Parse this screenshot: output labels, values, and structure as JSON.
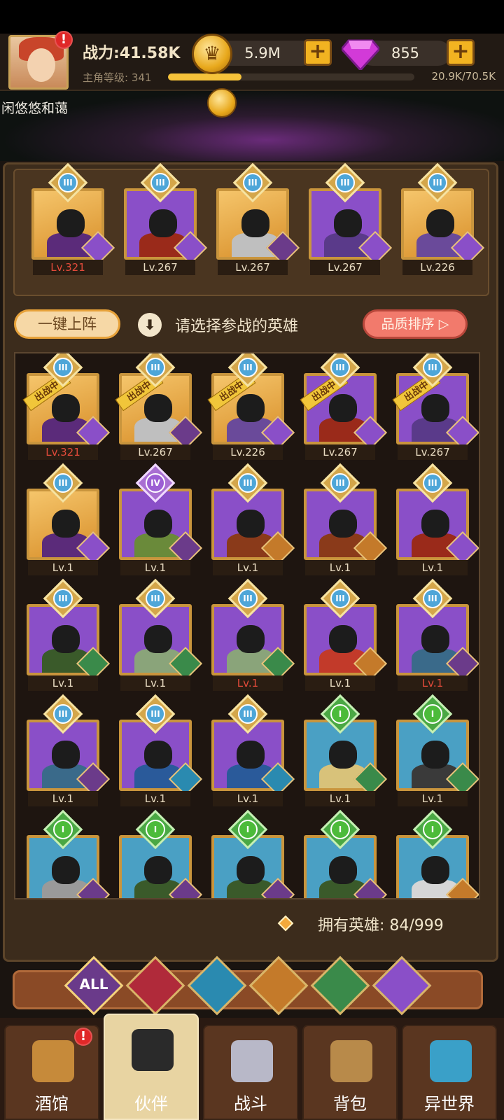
{
  "header": {
    "power": "战力:41.58K",
    "level_label": "主角等级: 341",
    "xp_text": "20.9K/70.5K",
    "xp_progress": 0.297,
    "gold": "5.9M",
    "gems": "855",
    "alert": "!"
  },
  "scene": {
    "player_name": "闲悠悠和蔼"
  },
  "team": [
    {
      "level": "Lv.321",
      "red": true,
      "bg": "gold",
      "rank": "III",
      "hero": "#5b2b7a",
      "faction": "#8a4fc8"
    },
    {
      "level": "Lv.267",
      "red": false,
      "bg": "purple",
      "rank": "III",
      "hero": "#9a2a1a",
      "faction": "#8a4fc8"
    },
    {
      "level": "Lv.267",
      "red": false,
      "bg": "gold",
      "rank": "III",
      "hero": "#bfbfbf",
      "faction": "#6b3b8a"
    },
    {
      "level": "Lv.267",
      "red": false,
      "bg": "purple",
      "rank": "III",
      "hero": "#5a3a8a",
      "faction": "#8a4fc8"
    },
    {
      "level": "Lv.226",
      "red": false,
      "bg": "gold",
      "rank": "III",
      "hero": "#6a4a9a",
      "faction": "#8a4fc8"
    }
  ],
  "controls": {
    "auto_deploy": "一键上阵",
    "hint": "请选择参战的英雄",
    "sort": "品质排序 ▷"
  },
  "heroes": [
    {
      "level": "Lv.321",
      "red": true,
      "bg": "gold",
      "rank": "III",
      "battle": true,
      "hero": "#5b2b7a",
      "faction": "#8a4fc8"
    },
    {
      "level": "Lv.267",
      "red": false,
      "bg": "gold",
      "rank": "III",
      "battle": true,
      "hero": "#bfbfbf",
      "faction": "#6b3b8a"
    },
    {
      "level": "Lv.226",
      "red": false,
      "bg": "gold",
      "rank": "III",
      "battle": true,
      "hero": "#6a4a9a",
      "faction": "#8a4fc8"
    },
    {
      "level": "Lv.267",
      "red": false,
      "bg": "purple",
      "rank": "III",
      "battle": true,
      "hero": "#9a2a1a",
      "faction": "#8a4fc8"
    },
    {
      "level": "Lv.267",
      "red": false,
      "bg": "purple",
      "rank": "III",
      "battle": true,
      "hero": "#5a3a8a",
      "faction": "#8a4fc8"
    },
    {
      "level": "Lv.1",
      "red": false,
      "bg": "gold",
      "rank": "III",
      "battle": false,
      "hero": "#5b2b7a",
      "faction": "#8a4fc8"
    },
    {
      "level": "Lv.1",
      "red": false,
      "bg": "purple",
      "rank": "IV",
      "battle": false,
      "hero": "#6a8a3a",
      "faction": "#6b3b8a"
    },
    {
      "level": "Lv.1",
      "red": false,
      "bg": "purple",
      "rank": "III",
      "battle": false,
      "hero": "#8a3a1a",
      "faction": "#c47a2a"
    },
    {
      "level": "Lv.1",
      "red": false,
      "bg": "purple",
      "rank": "III",
      "battle": false,
      "hero": "#8a3a1a",
      "faction": "#c47a2a"
    },
    {
      "level": "Lv.1",
      "red": false,
      "bg": "purple",
      "rank": "III",
      "battle": false,
      "hero": "#9a2a1a",
      "faction": "#8a4fc8"
    },
    {
      "level": "Lv.1",
      "red": false,
      "bg": "purple",
      "rank": "III",
      "battle": false,
      "hero": "#3a5a2a",
      "faction": "#3a8a4a"
    },
    {
      "level": "Lv.1",
      "red": false,
      "bg": "purple",
      "rank": "III",
      "battle": false,
      "hero": "#8aa47a",
      "faction": "#3a8a4a"
    },
    {
      "level": "Lv.1",
      "red": true,
      "bg": "purple",
      "rank": "III",
      "battle": false,
      "hero": "#8aa47a",
      "faction": "#3a8a4a"
    },
    {
      "level": "Lv.1",
      "red": false,
      "bg": "purple",
      "rank": "III",
      "battle": false,
      "hero": "#c23a2a",
      "faction": "#c47a2a"
    },
    {
      "level": "Lv.1",
      "red": true,
      "bg": "purple",
      "rank": "III",
      "battle": false,
      "hero": "#3a6a8a",
      "faction": "#6b3b8a"
    },
    {
      "level": "Lv.1",
      "red": false,
      "bg": "purple",
      "rank": "III",
      "battle": false,
      "hero": "#3a6a8a",
      "faction": "#6b3b8a"
    },
    {
      "level": "Lv.1",
      "red": false,
      "bg": "purple",
      "rank": "III",
      "battle": false,
      "hero": "#2a5a9a",
      "faction": "#2a8ab0"
    },
    {
      "level": "Lv.1",
      "red": false,
      "bg": "purple",
      "rank": "III",
      "battle": false,
      "hero": "#2a5a9a",
      "faction": "#2a8ab0"
    },
    {
      "level": "Lv.1",
      "red": false,
      "bg": "teal",
      "rank": "I",
      "battle": false,
      "hero": "#d8c27a",
      "faction": "#3a8a4a"
    },
    {
      "level": "Lv.1",
      "red": false,
      "bg": "teal",
      "rank": "I",
      "battle": false,
      "hero": "#3a3a3a",
      "faction": "#3a8a4a"
    },
    {
      "level": "",
      "red": false,
      "bg": "teal",
      "rank": "I",
      "battle": false,
      "hero": "#9a9a9a",
      "faction": "#6b3b8a"
    },
    {
      "level": "",
      "red": false,
      "bg": "teal",
      "rank": "I",
      "battle": false,
      "hero": "#3a5a2a",
      "faction": "#6b3b8a"
    },
    {
      "level": "",
      "red": false,
      "bg": "teal",
      "rank": "I",
      "battle": false,
      "hero": "#3a5a2a",
      "faction": "#6b3b8a"
    },
    {
      "level": "",
      "red": false,
      "bg": "teal",
      "rank": "I",
      "battle": false,
      "hero": "#3a5a2a",
      "faction": "#6b3b8a"
    },
    {
      "level": "",
      "red": false,
      "bg": "teal",
      "rank": "I",
      "battle": false,
      "hero": "#d6d6d6",
      "faction": "#c47a2a"
    }
  ],
  "in_battle_label": "出战中",
  "owned": "拥有英雄: 84/999",
  "filters": [
    {
      "label": "ALL",
      "color": "#6a3a8a",
      "name": "filter-all"
    },
    {
      "label": "",
      "color": "#b02a3a",
      "name": "filter-human"
    },
    {
      "label": "",
      "color": "#2a8ab0",
      "name": "filter-elemental"
    },
    {
      "label": "",
      "color": "#c47a2a",
      "name": "filter-beast"
    },
    {
      "label": "",
      "color": "#3a8a4a",
      "name": "filter-elf"
    },
    {
      "label": "",
      "color": "#8a4fc8",
      "name": "filter-undead"
    }
  ],
  "nav": [
    {
      "label": "酒馆",
      "name": "nav-tavern",
      "icon": "#c68a3a",
      "alert": true
    },
    {
      "label": "伙伴",
      "name": "nav-partners",
      "icon": "#2a2a2a",
      "active": true
    },
    {
      "label": "战斗",
      "name": "nav-battle",
      "icon": "#b8b8c8"
    },
    {
      "label": "背包",
      "name": "nav-bag",
      "icon": "#b88a4a"
    },
    {
      "label": "异世界",
      "name": "nav-otherworld",
      "icon": "#3aa0c8"
    }
  ]
}
